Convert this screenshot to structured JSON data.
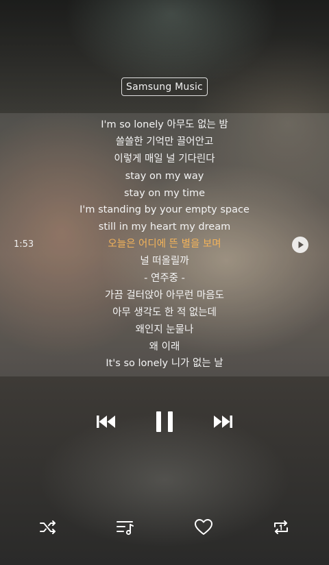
{
  "app": {
    "label": "Samsung Music"
  },
  "player": {
    "elapsed_time": "1:53"
  },
  "lyrics": {
    "lines": [
      "I'm so lonely 아무도 없는 밤",
      "쓸쓸한 기억만 끌어안고",
      "이렇게 매일 널 기다린다",
      "stay on my way",
      "stay on my time",
      "I'm standing by your empty space",
      "still in my heart my dream",
      "오늘은 어디에 뜬 별을 보며",
      "널 떠올릴까",
      "- 연주중 -",
      "가끔 걸터앉아 아무런 마음도",
      "아무 생각도 한 적 없는데",
      "왜인지 눈물나",
      "왜 이래",
      "It's so lonely 니가 없는 날"
    ],
    "active_index": 7,
    "active_color": "#f3b35a"
  },
  "controls": {
    "prev_icon": "skip-previous-icon",
    "pause_icon": "pause-icon",
    "next_icon": "skip-next-icon",
    "shuffle_icon": "shuffle-icon",
    "playlist_icon": "playlist-icon",
    "favorite_icon": "heart-outline-icon",
    "repeat_icon": "repeat-one-icon"
  }
}
